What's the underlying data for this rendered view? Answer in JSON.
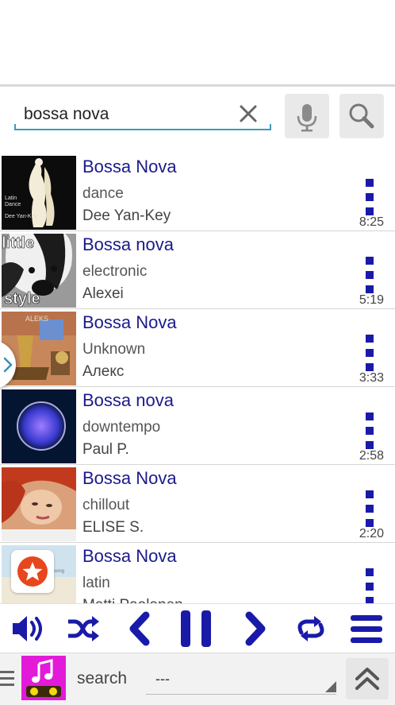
{
  "search": {
    "value": "bossa nova",
    "clear_icon": "close-icon",
    "mic_icon": "microphone-icon",
    "search_icon": "magnifier-icon"
  },
  "tracks": [
    {
      "title": "Bossa Nova",
      "genre": "dance",
      "artist": "Dee Yan-Key",
      "duration": "8:25",
      "art_text": [
        "Latin",
        "Dance",
        "Dee Yan-Key"
      ]
    },
    {
      "title": "Bossa nova",
      "genre": "electronic",
      "artist": "Alexei",
      "duration": "5:19",
      "art_text": [
        "little",
        "style"
      ]
    },
    {
      "title": "Bossa Nova",
      "genre": "Unknown",
      "artist": "Алекс",
      "duration": "3:33",
      "art_text": [
        "ALEKS"
      ]
    },
    {
      "title": "Bossa nova",
      "genre": "downtempo",
      "artist": "Paul P.",
      "duration": "2:58"
    },
    {
      "title": "Bossa Nova",
      "genre": "chillout",
      "artist": "ELISE S.",
      "duration": "2:20"
    },
    {
      "title": "Bossa Nova",
      "genre": "latin",
      "artist": "Matti Paalanen",
      "duration": ""
    }
  ],
  "player": {
    "buttons": [
      "volume-icon",
      "shuffle-icon",
      "previous-icon",
      "pause-icon",
      "next-icon",
      "repeat-icon",
      "menu-icon"
    ]
  },
  "bottom": {
    "search_label": "search",
    "dropdown_value": "---"
  },
  "colors": {
    "accent_blue": "#1a1aa8",
    "title_blue": "#1a1a8c",
    "underline": "#3b9bbd",
    "app_icon_bg": "#e21bd9"
  }
}
